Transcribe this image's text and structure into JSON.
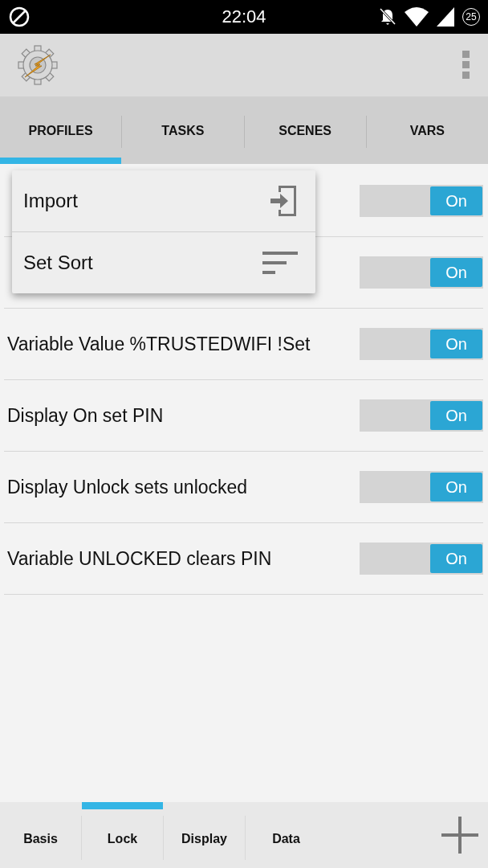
{
  "status_bar": {
    "time": "22:04",
    "battery_level_text": "25"
  },
  "tabs": [
    {
      "label": "PROFILES",
      "selected": true
    },
    {
      "label": "TASKS",
      "selected": false
    },
    {
      "label": "SCENES",
      "selected": false
    },
    {
      "label": "VARS",
      "selected": false
    }
  ],
  "profiles": [
    {
      "on": true,
      "toggle_text": "On"
    },
    {
      "on": true,
      "toggle_text": "On"
    },
    {
      "name": "Variable Value %TRUSTEDWIFI !Set",
      "on": true,
      "toggle_text": "On"
    },
    {
      "name": "Display On set PIN",
      "on": true,
      "toggle_text": "On"
    },
    {
      "name": "Display Unlock sets unlocked",
      "on": true,
      "toggle_text": "On"
    },
    {
      "name": "Variable UNLOCKED clears PIN",
      "on": true,
      "toggle_text": "On"
    }
  ],
  "menu": [
    {
      "label": "Import",
      "kind": "import"
    },
    {
      "label": "Set Sort",
      "kind": "sort"
    }
  ],
  "project_tabs": [
    {
      "label": "Basis",
      "selected": false
    },
    {
      "label": "Lock",
      "selected": true
    },
    {
      "label": "Display",
      "selected": false
    },
    {
      "label": "Data",
      "selected": false
    }
  ]
}
